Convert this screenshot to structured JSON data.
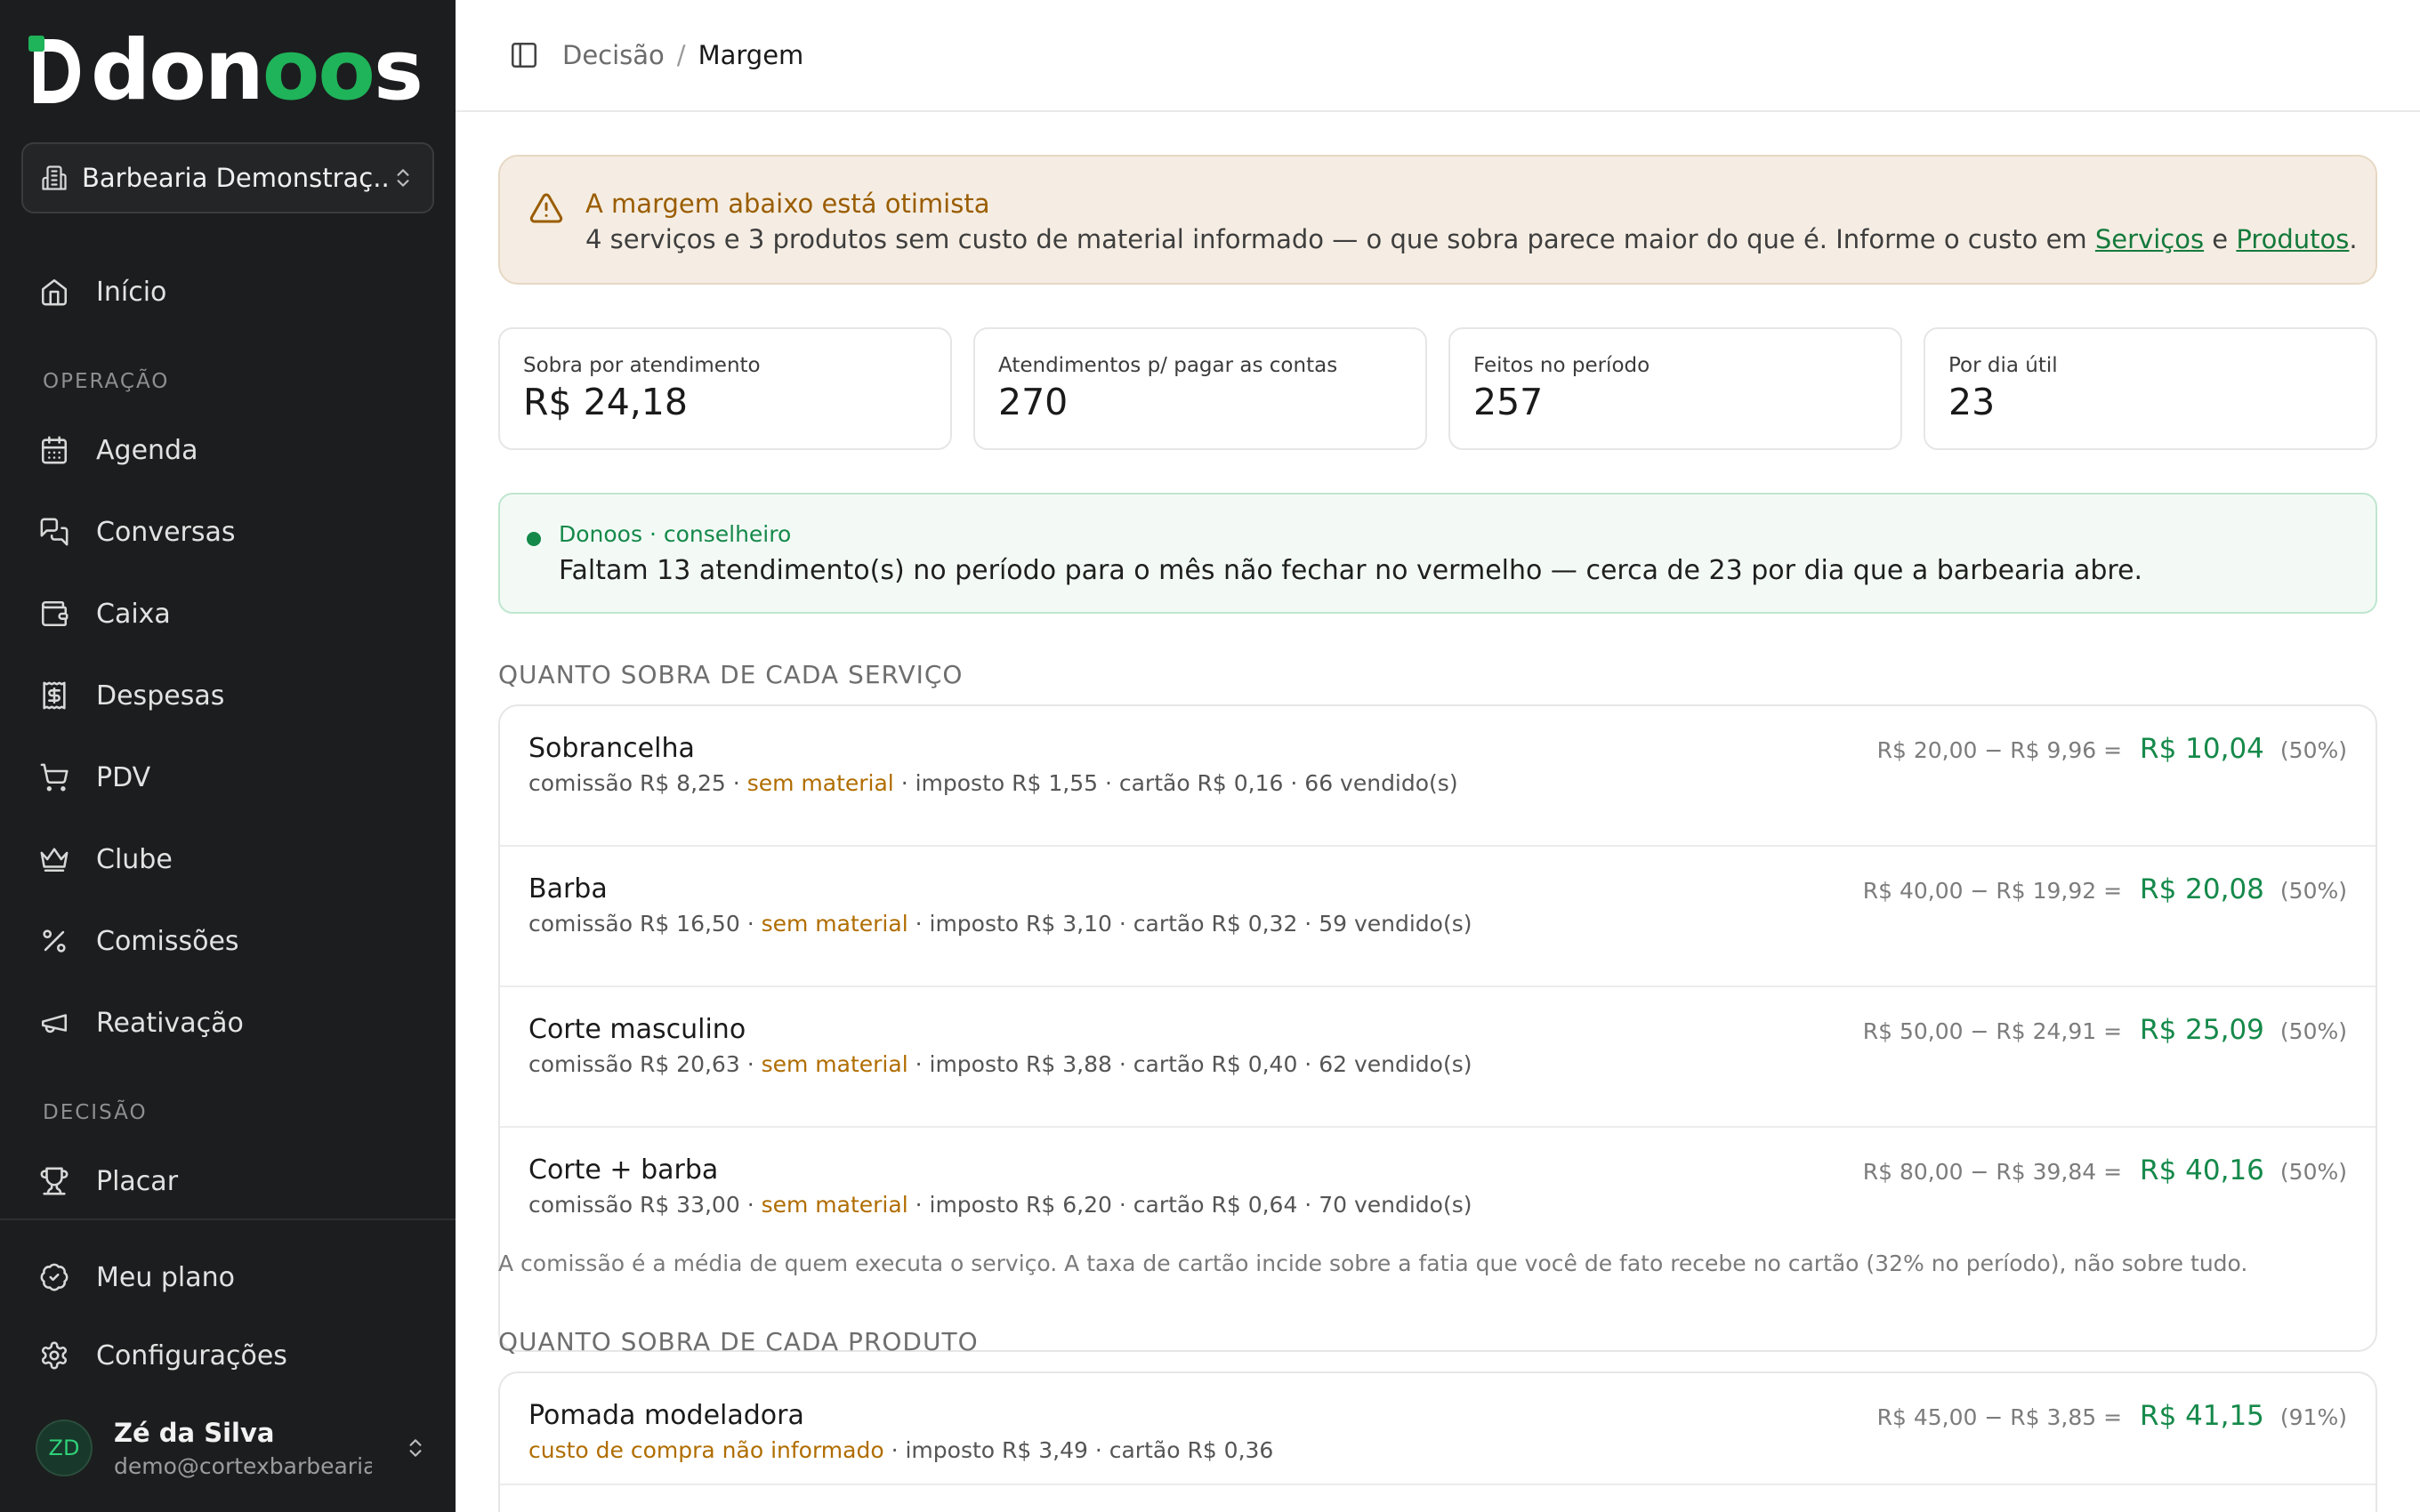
{
  "sidebar": {
    "logo_text": "donoos",
    "org_name": "Barbearia Demonstraç...",
    "items": [
      {
        "label": "Início",
        "icon": "home-icon"
      },
      {
        "label": "Agenda",
        "icon": "calendar-icon"
      },
      {
        "label": "Conversas",
        "icon": "chat-icon"
      },
      {
        "label": "Caixa",
        "icon": "wallet-icon"
      },
      {
        "label": "Despesas",
        "icon": "receipt-icon"
      },
      {
        "label": "PDV",
        "icon": "cart-icon"
      },
      {
        "label": "Clube",
        "icon": "crown-icon"
      },
      {
        "label": "Comissões",
        "icon": "percent-icon"
      },
      {
        "label": "Reativação",
        "icon": "megaphone-icon"
      },
      {
        "label": "Placar",
        "icon": "trophy-icon"
      },
      {
        "label": "Meu plano",
        "icon": "check-circle-icon"
      },
      {
        "label": "Configurações",
        "icon": "gear-icon"
      }
    ],
    "sections": {
      "operacao": "OPERAÇÃO",
      "decisao": "DECISÃO"
    },
    "user": {
      "initials": "ZD",
      "name": "Zé da Silva",
      "email": "demo@cortexbarbearia..."
    }
  },
  "header": {
    "breadcrumb_parent": "Decisão",
    "breadcrumb_sep": "/",
    "breadcrumb_current": "Margem"
  },
  "alert": {
    "title": "A margem abaixo está otimista",
    "text": "4 serviços e 3 produtos sem custo de material informado — o que sobra parece maior do que é. Informe o custo em ",
    "link_servicos": "Serviços",
    "conjunction": " e ",
    "link_produtos": "Produtos",
    "end": "."
  },
  "stats": [
    {
      "label": "Sobra por atendimento",
      "value": "R$ 24,18"
    },
    {
      "label": "Atendimentos p/ pagar as contas",
      "value": "270"
    },
    {
      "label": "Feitos no período",
      "value": "257"
    },
    {
      "label": "Por dia útil",
      "value": "23"
    }
  ],
  "advisor": {
    "title": "Donoos · conselheiro",
    "text": "Faltam 13 atendimento(s) no período para o mês não fechar no vermelho — cerca de 23 por dia que a barbearia abre."
  },
  "services_section": {
    "title": "QUANTO SOBRA DE CADA SERVIÇO",
    "rows": [
      {
        "name": "Sobrancelha",
        "detail_a": "comissão R$ 8,25 · ",
        "warn": "sem material",
        "detail_b": " · imposto R$ 1,55 · cartão R$ 0,16 · 66 vendido(s)",
        "formula": "R$ 20,00 − R$ 9,96 =",
        "result": "R$ 10,04",
        "pct": "(50%)"
      },
      {
        "name": "Barba",
        "detail_a": "comissão R$ 16,50 · ",
        "warn": "sem material",
        "detail_b": " · imposto R$ 3,10 · cartão R$ 0,32 · 59 vendido(s)",
        "formula": "R$ 40,00 − R$ 19,92 =",
        "result": "R$ 20,08",
        "pct": "(50%)"
      },
      {
        "name": "Corte masculino",
        "detail_a": "comissão R$ 20,63 · ",
        "warn": "sem material",
        "detail_b": " · imposto R$ 3,88 · cartão R$ 0,40 · 62 vendido(s)",
        "formula": "R$ 50,00 − R$ 24,91 =",
        "result": "R$ 25,09",
        "pct": "(50%)"
      },
      {
        "name": "Corte + barba",
        "detail_a": "comissão R$ 33,00 · ",
        "warn": "sem material",
        "detail_b": " · imposto R$ 6,20 · cartão R$ 0,64 · 70 vendido(s)",
        "formula": "R$ 80,00 − R$ 39,84 =",
        "result": "R$ 40,16",
        "pct": "(50%)"
      }
    ],
    "footnote": "A comissão é a média de quem executa o serviço. A taxa de cartão incide sobre a fatia que você de fato recebe no cartão (32% no período), não sobre tudo."
  },
  "products_section": {
    "title": "QUANTO SOBRA DE CADA PRODUTO",
    "rows": [
      {
        "name": "Pomada modeladora",
        "warn": "custo de compra não informado",
        "detail_b": " · imposto R$ 3,49 · cartão R$ 0,36",
        "formula": "R$ 45,00 − R$ 3,85 =",
        "result": "R$ 41,15",
        "pct": "(91%)"
      }
    ]
  }
}
